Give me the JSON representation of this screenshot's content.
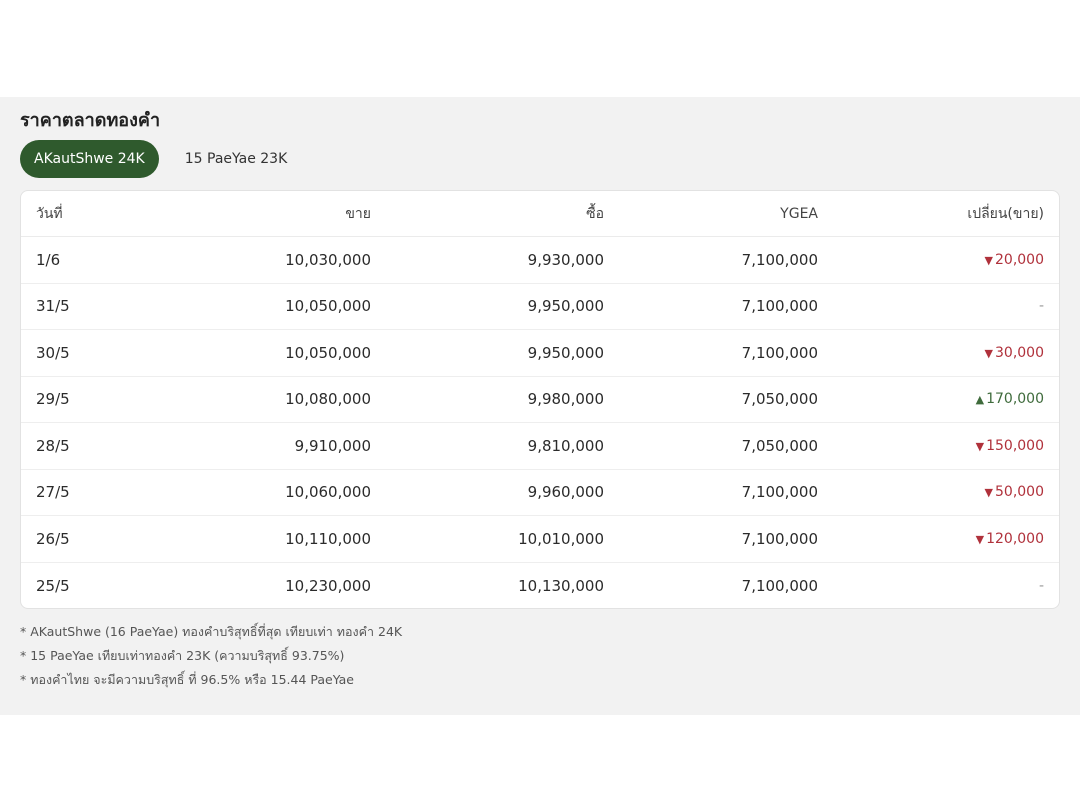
{
  "title": "ราคาตลาดทองคำ",
  "tabs": [
    {
      "label": "AKautShwe 24K",
      "active": true
    },
    {
      "label": "15 PaeYae 23K",
      "active": false
    }
  ],
  "table": {
    "headers": {
      "date": "วันที่",
      "sell": "ขาย",
      "buy": "ซื้อ",
      "ygea": "YGEA",
      "change": "เปลี่ยน(ขาย)"
    },
    "rows": [
      {
        "date": "1/6",
        "sell": "10,030,000",
        "buy": "9,930,000",
        "ygea": "7,100,000",
        "dir": "down",
        "change": "20,000"
      },
      {
        "date": "31/5",
        "sell": "10,050,000",
        "buy": "9,950,000",
        "ygea": "7,100,000",
        "dir": "none",
        "change": "-"
      },
      {
        "date": "30/5",
        "sell": "10,050,000",
        "buy": "9,950,000",
        "ygea": "7,100,000",
        "dir": "down",
        "change": "30,000"
      },
      {
        "date": "29/5",
        "sell": "10,080,000",
        "buy": "9,980,000",
        "ygea": "7,050,000",
        "dir": "up",
        "change": "170,000"
      },
      {
        "date": "28/5",
        "sell": "9,910,000",
        "buy": "9,810,000",
        "ygea": "7,050,000",
        "dir": "down",
        "change": "150,000"
      },
      {
        "date": "27/5",
        "sell": "10,060,000",
        "buy": "9,960,000",
        "ygea": "7,100,000",
        "dir": "down",
        "change": "50,000"
      },
      {
        "date": "26/5",
        "sell": "10,110,000",
        "buy": "10,010,000",
        "ygea": "7,100,000",
        "dir": "down",
        "change": "120,000"
      },
      {
        "date": "25/5",
        "sell": "10,230,000",
        "buy": "10,130,000",
        "ygea": "7,100,000",
        "dir": "none",
        "change": "-"
      }
    ]
  },
  "notes": [
    "* AKautShwe (16 PaeYae) ทองคำบริสุทธิ์ที่สุด เทียบเท่า ทองคำ 24K",
    "* 15 PaeYae เทียบเท่าทองคำ 23K (ความบริสุทธิ์ 93.75%)",
    "* ทองคำไทย จะมีความบริสุทธิ์ ที่ 96.5% หรือ 15.44 PaeYae"
  ],
  "colors": {
    "accent": "#2f5a2d",
    "down": "#b0313b",
    "up": "#3f6b3c"
  },
  "icons": {
    "down": "triangle-down-icon",
    "up": "triangle-up-icon"
  }
}
